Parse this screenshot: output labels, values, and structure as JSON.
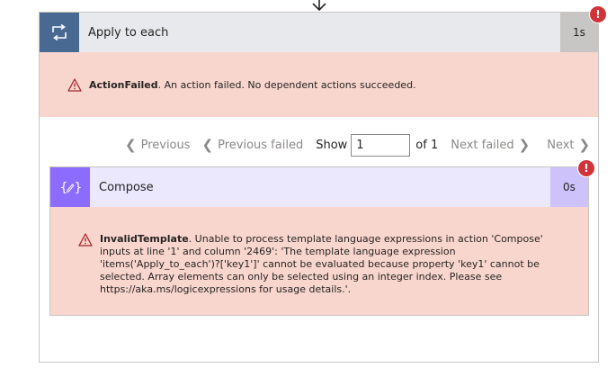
{
  "loop": {
    "title": "Apply to each",
    "duration": "1s",
    "badge": "!",
    "error_code": "ActionFailed",
    "error_message": ". An action failed. No dependent actions succeeded."
  },
  "pager": {
    "previous": "Previous",
    "previous_failed": "Previous failed",
    "show_label": "Show",
    "page_value": "1",
    "of_label": "of 1",
    "next_failed": "Next failed",
    "next": "Next"
  },
  "compose": {
    "title": "Compose",
    "duration": "0s",
    "badge": "!",
    "error_code": "InvalidTemplate",
    "error_message": ". Unable to process template language expressions in action 'Compose' inputs at line '1' and column '2469': 'The template language expression 'items('Apply_to_each')?['key1']' cannot be evaluated because property 'key1' cannot be selected. Array elements can only be selected using an integer index. Please see https://aka.ms/logicexpressions for usage details.'."
  },
  "colors": {
    "loop_accent": "#486991",
    "compose_accent": "#8c6cff",
    "error_bg": "#f9d6cd",
    "badge_red": "#d13438"
  },
  "icons": {
    "connector": "arrow-down-icon",
    "loop": "loop-icon",
    "compose": "compose-icon",
    "warning": "warning-icon",
    "badge": "error-badge"
  }
}
